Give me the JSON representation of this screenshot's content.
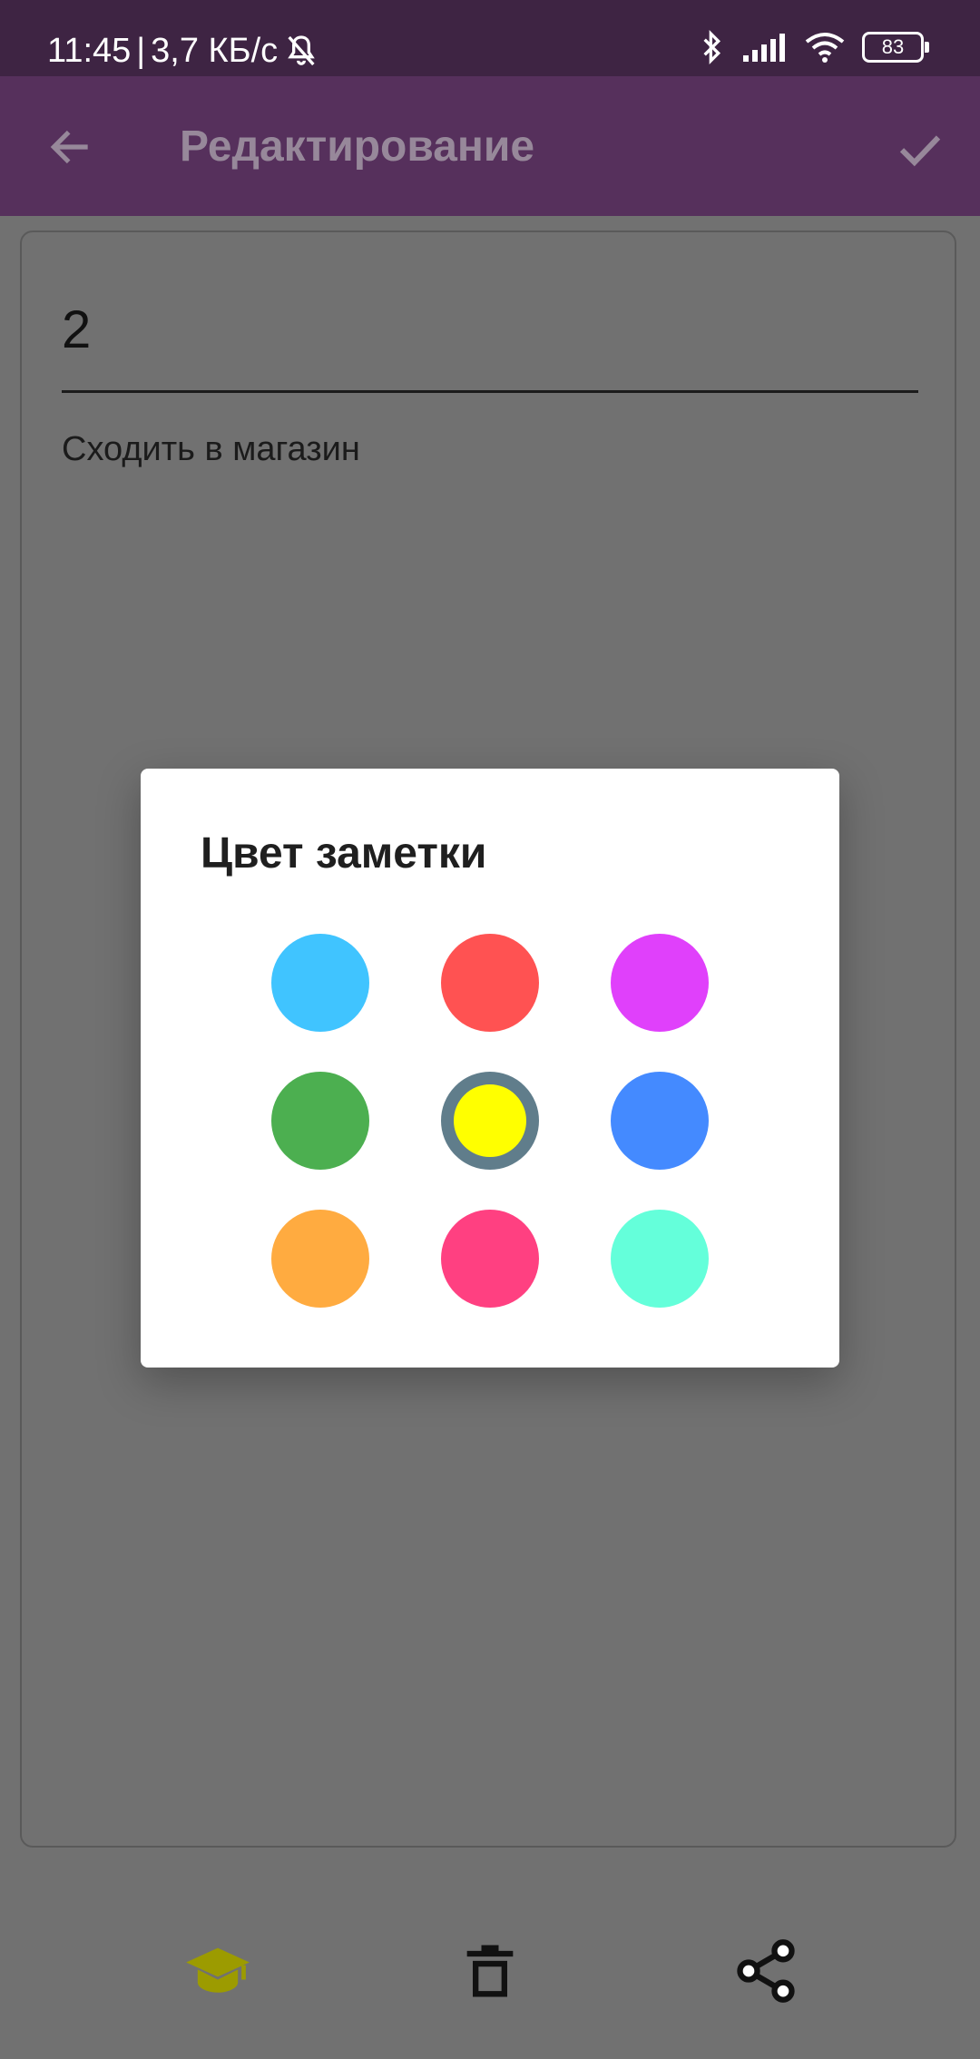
{
  "status_bar": {
    "time": "11:45",
    "separator": "|",
    "network_speed": "3,7 КБ/с",
    "battery_level": "83",
    "icons": [
      "mute-bell-icon",
      "bluetooth-icon",
      "cellular-signal-icon",
      "wifi-icon",
      "battery-icon"
    ]
  },
  "app_bar": {
    "title": "Редактирование",
    "back_icon": "arrow-back-icon",
    "confirm_icon": "check-icon"
  },
  "note": {
    "title": "2",
    "body": "Сходить в магазин"
  },
  "bottom_bar": {
    "icons": [
      "graduation-cap-icon",
      "trash-icon",
      "share-icon"
    ],
    "cap_color": "#9c9b00"
  },
  "dialog": {
    "title": "Цвет заметки",
    "colors": [
      {
        "name": "light-blue",
        "hex": "#40c4ff",
        "selected": false
      },
      {
        "name": "red",
        "hex": "#ff5252",
        "selected": false
      },
      {
        "name": "magenta",
        "hex": "#e040fb",
        "selected": false
      },
      {
        "name": "green",
        "hex": "#4caf50",
        "selected": false
      },
      {
        "name": "yellow",
        "hex": "#ffff00",
        "selected": true
      },
      {
        "name": "blue",
        "hex": "#448aff",
        "selected": false
      },
      {
        "name": "orange",
        "hex": "#ffab40",
        "selected": false
      },
      {
        "name": "pink",
        "hex": "#ff4081",
        "selected": false
      },
      {
        "name": "teal",
        "hex": "#64ffda",
        "selected": false
      }
    ]
  }
}
